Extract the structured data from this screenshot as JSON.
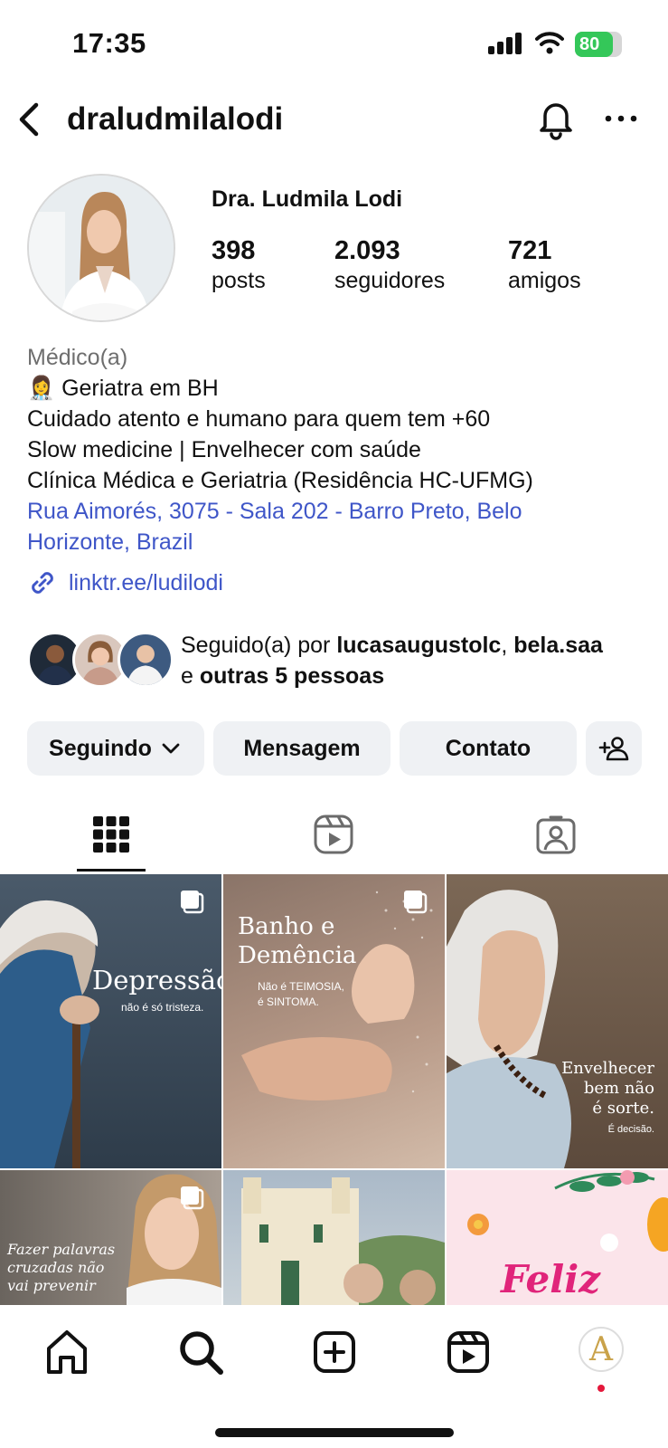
{
  "status_bar": {
    "time": "17:35",
    "battery": "80",
    "battery_level": 0.8
  },
  "header": {
    "username": "draludmilalodi"
  },
  "profile": {
    "display_name": "Dra. Ludmila Lodi",
    "stats": [
      {
        "value": "398",
        "label": "posts"
      },
      {
        "value": "2.093",
        "label": "seguidores"
      },
      {
        "value": "721",
        "label": "amigos"
      }
    ],
    "category": "Médico(a)",
    "bio_lines": [
      "👩‍⚕️ Geriatra em BH",
      "Cuidado atento e humano para quem tem +60",
      "Slow medicine | Envelhecer com saúde",
      "Clínica Médica e Geriatria (Residência HC-UFMG)"
    ],
    "address_line1": "Rua Aimorés, 3075 - Sala 202 - Barro Preto, Belo",
    "address_line2": "Horizonte, Brazil",
    "link": "linktr.ee/ludilodi"
  },
  "followed_by": {
    "prefix": "Seguido(a) por",
    "user1": "lucasaugustolc",
    "separator": ",",
    "user2": "bela.saa",
    "connector": "e",
    "others": "outras 5 pessoas"
  },
  "actions": {
    "following": "Seguindo",
    "message": "Mensagem",
    "contact": "Contato"
  },
  "posts": [
    {
      "title": "Depressão",
      "subtitle": "não é só tristeza."
    },
    {
      "title_line1": "Banho e",
      "title_line2": "Demência",
      "subtitle_line1": "Não é TEIMOSIA,",
      "subtitle_line2": "é SINTOMA."
    },
    {
      "title_line1": "Envelhecer",
      "title_line2": "bem não",
      "title_line3": "é sorte.",
      "subtitle": "É decisão."
    },
    {
      "title_line1": "Fazer palavras",
      "title_line2": "cruzadas não",
      "title_line3": "vai prevenir"
    },
    {
      "title": ""
    },
    {
      "title": "Feliz"
    }
  ],
  "nav": {
    "profile_initial": "A"
  }
}
